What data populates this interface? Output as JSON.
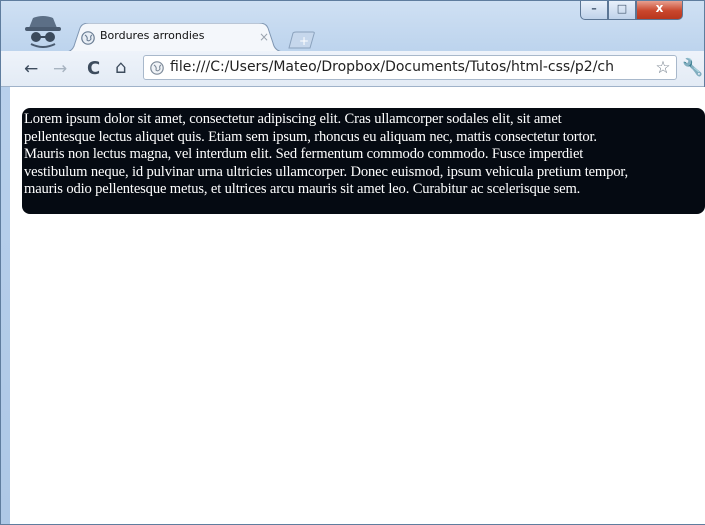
{
  "window": {
    "tab_title": "Bordures arrondies",
    "tab_close": "×",
    "new_tab": "+",
    "min_label": "–",
    "max_label": "□",
    "close_label": "x"
  },
  "toolbar": {
    "back": "←",
    "forward": "→",
    "reload": "C",
    "home": "⌂",
    "url": "file:///C:/Users/Mateo/Dropbox/Documents/Tutos/html-css/p2/ch",
    "bookmark": "☆",
    "wrench": "🔧"
  },
  "content": {
    "paragraph_lines": [
      "Lorem ipsum dolor sit amet, consectetur adipiscing elit. Cras ullamcorper sodales elit, sit amet",
      "pellentesque lectus aliquet quis. Etiam sem ipsum, rhoncus eu aliquam nec, mattis consectetur tortor.",
      "Mauris non lectus magna, vel interdum elit. Sed fermentum commodo commodo. Fusce imperdiet",
      "vestibulum neque, id pulvinar urna ultricies ullamcorper. Donec euismod, ipsum vehicula pretium tempor,",
      "mauris odio pellentesque metus, et ultrices arcu mauris sit amet leo. Curabitur ac scelerisque sem."
    ]
  },
  "colors": {
    "box_background": "#050a12",
    "box_text": "#ffffff",
    "close_button": "#c9462c"
  }
}
